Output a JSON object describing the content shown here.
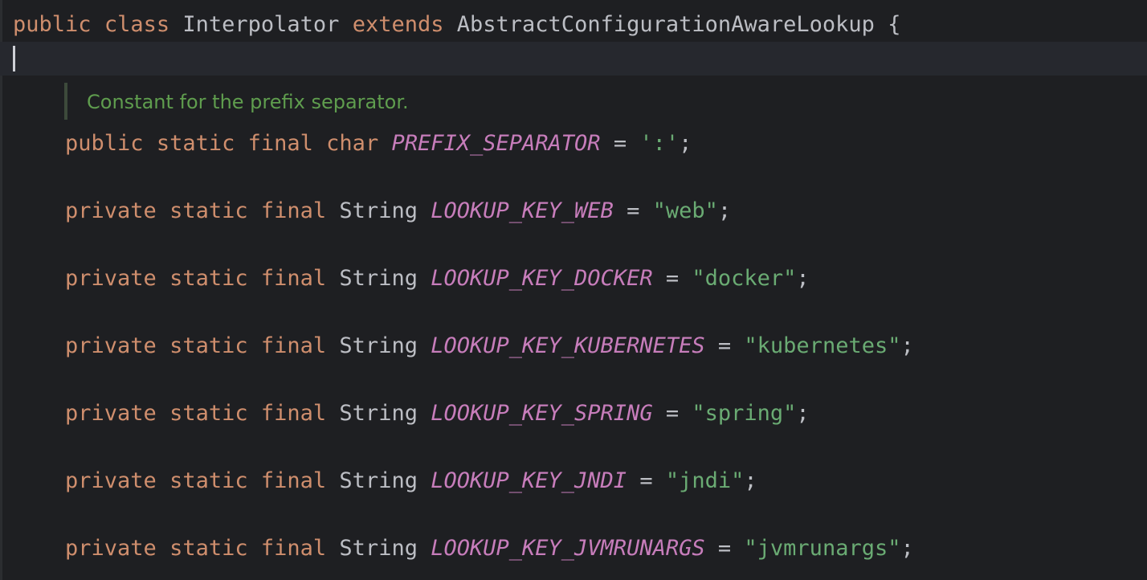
{
  "class_decl": {
    "kw_public": "public",
    "kw_class": "class",
    "name": "Interpolator",
    "kw_extends": "extends",
    "parent": "AbstractConfigurationAwareLookup",
    "brace": "{"
  },
  "doc_comment": "Constant for the prefix separator.",
  "fields": [
    {
      "modifiers": [
        "public",
        "static",
        "final",
        "char"
      ],
      "type": "",
      "name": "PREFIX_SEPARATOR",
      "eq": "=",
      "value": "':'",
      "semi": ";"
    },
    {
      "modifiers": [
        "private",
        "static",
        "final"
      ],
      "type": "String",
      "name": "LOOKUP_KEY_WEB",
      "eq": "=",
      "value": "\"web\"",
      "semi": ";"
    },
    {
      "modifiers": [
        "private",
        "static",
        "final"
      ],
      "type": "String",
      "name": "LOOKUP_KEY_DOCKER",
      "eq": "=",
      "value": "\"docker\"",
      "semi": ";"
    },
    {
      "modifiers": [
        "private",
        "static",
        "final"
      ],
      "type": "String",
      "name": "LOOKUP_KEY_KUBERNETES",
      "eq": "=",
      "value": "\"kubernetes\"",
      "semi": ";"
    },
    {
      "modifiers": [
        "private",
        "static",
        "final"
      ],
      "type": "String",
      "name": "LOOKUP_KEY_SPRING",
      "eq": "=",
      "value": "\"spring\"",
      "semi": ";"
    },
    {
      "modifiers": [
        "private",
        "static",
        "final"
      ],
      "type": "String",
      "name": "LOOKUP_KEY_JNDI",
      "eq": "=",
      "value": "\"jndi\"",
      "semi": ";"
    },
    {
      "modifiers": [
        "private",
        "static",
        "final"
      ],
      "type": "String",
      "name": "LOOKUP_KEY_JVMRUNARGS",
      "eq": "=",
      "value": "\"jvmrunargs\"",
      "semi": ";"
    }
  ],
  "colors": {
    "background": "#1e1f22",
    "keyword": "#cf8e6d",
    "identifier": "#bcbec4",
    "constant": "#c77dbb",
    "string": "#6aab73",
    "doc_comment": "#5f9d4e"
  }
}
